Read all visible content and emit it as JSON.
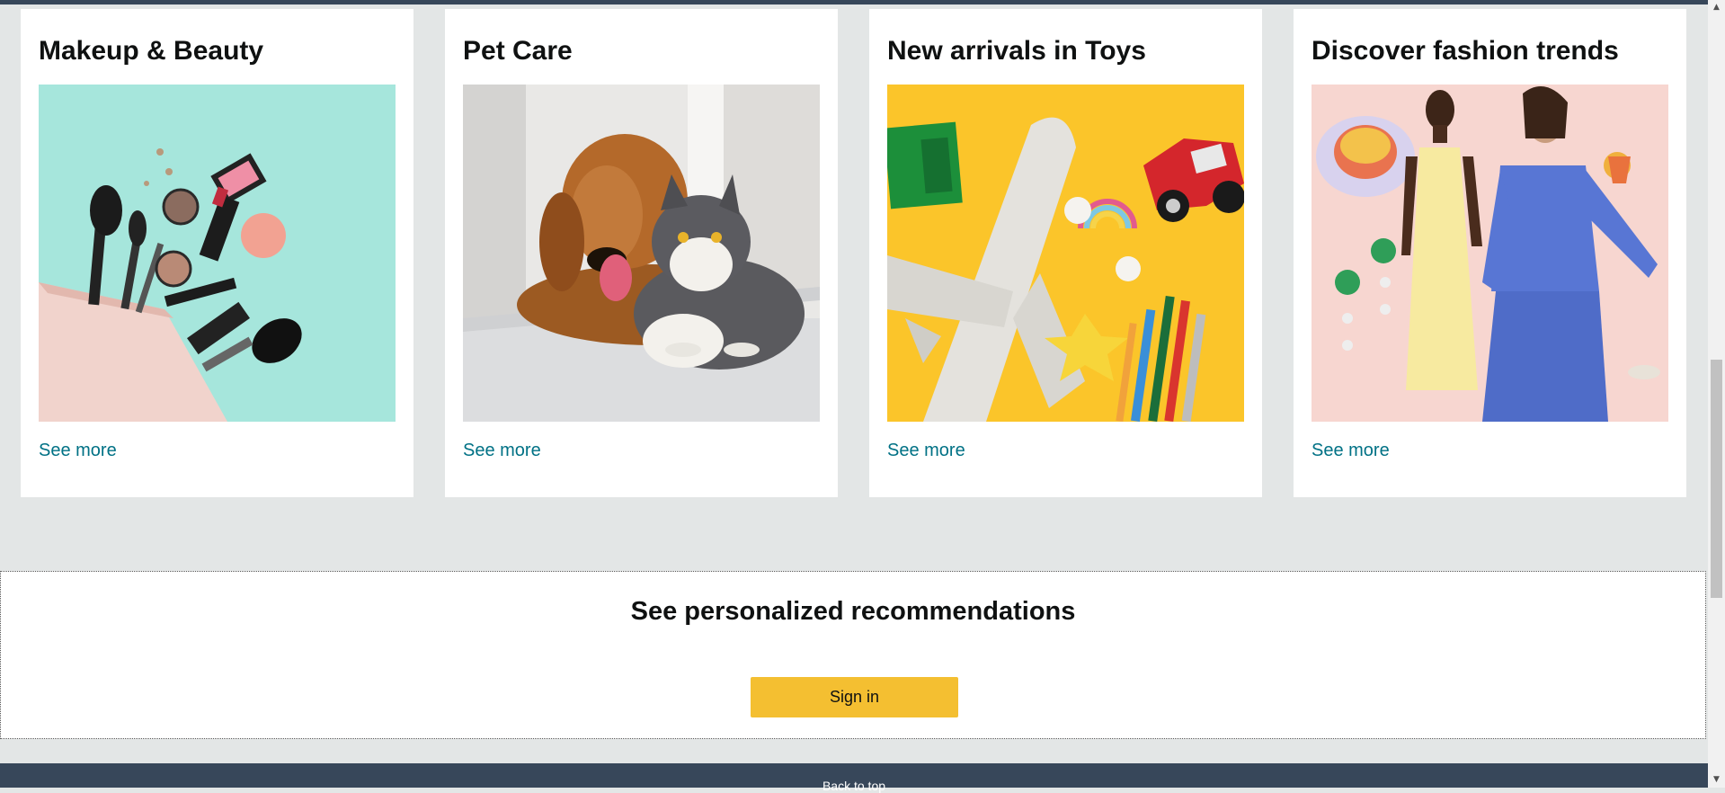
{
  "cards": [
    {
      "title": "Makeup & Beauty",
      "link": "See more"
    },
    {
      "title": "Pet Care",
      "link": "See more"
    },
    {
      "title": "New arrivals in Toys",
      "link": "See more"
    },
    {
      "title": "Discover fashion trends",
      "link": "See more"
    }
  ],
  "recommendations": {
    "heading": "See personalized recommendations",
    "signin_label": "Sign in"
  },
  "footer": {
    "back_to_top": "Back to top"
  },
  "colors": {
    "link": "#007185",
    "signin_button": "#f4bf31",
    "footer_bg": "#37475a",
    "page_bg": "#e3e6e6"
  }
}
